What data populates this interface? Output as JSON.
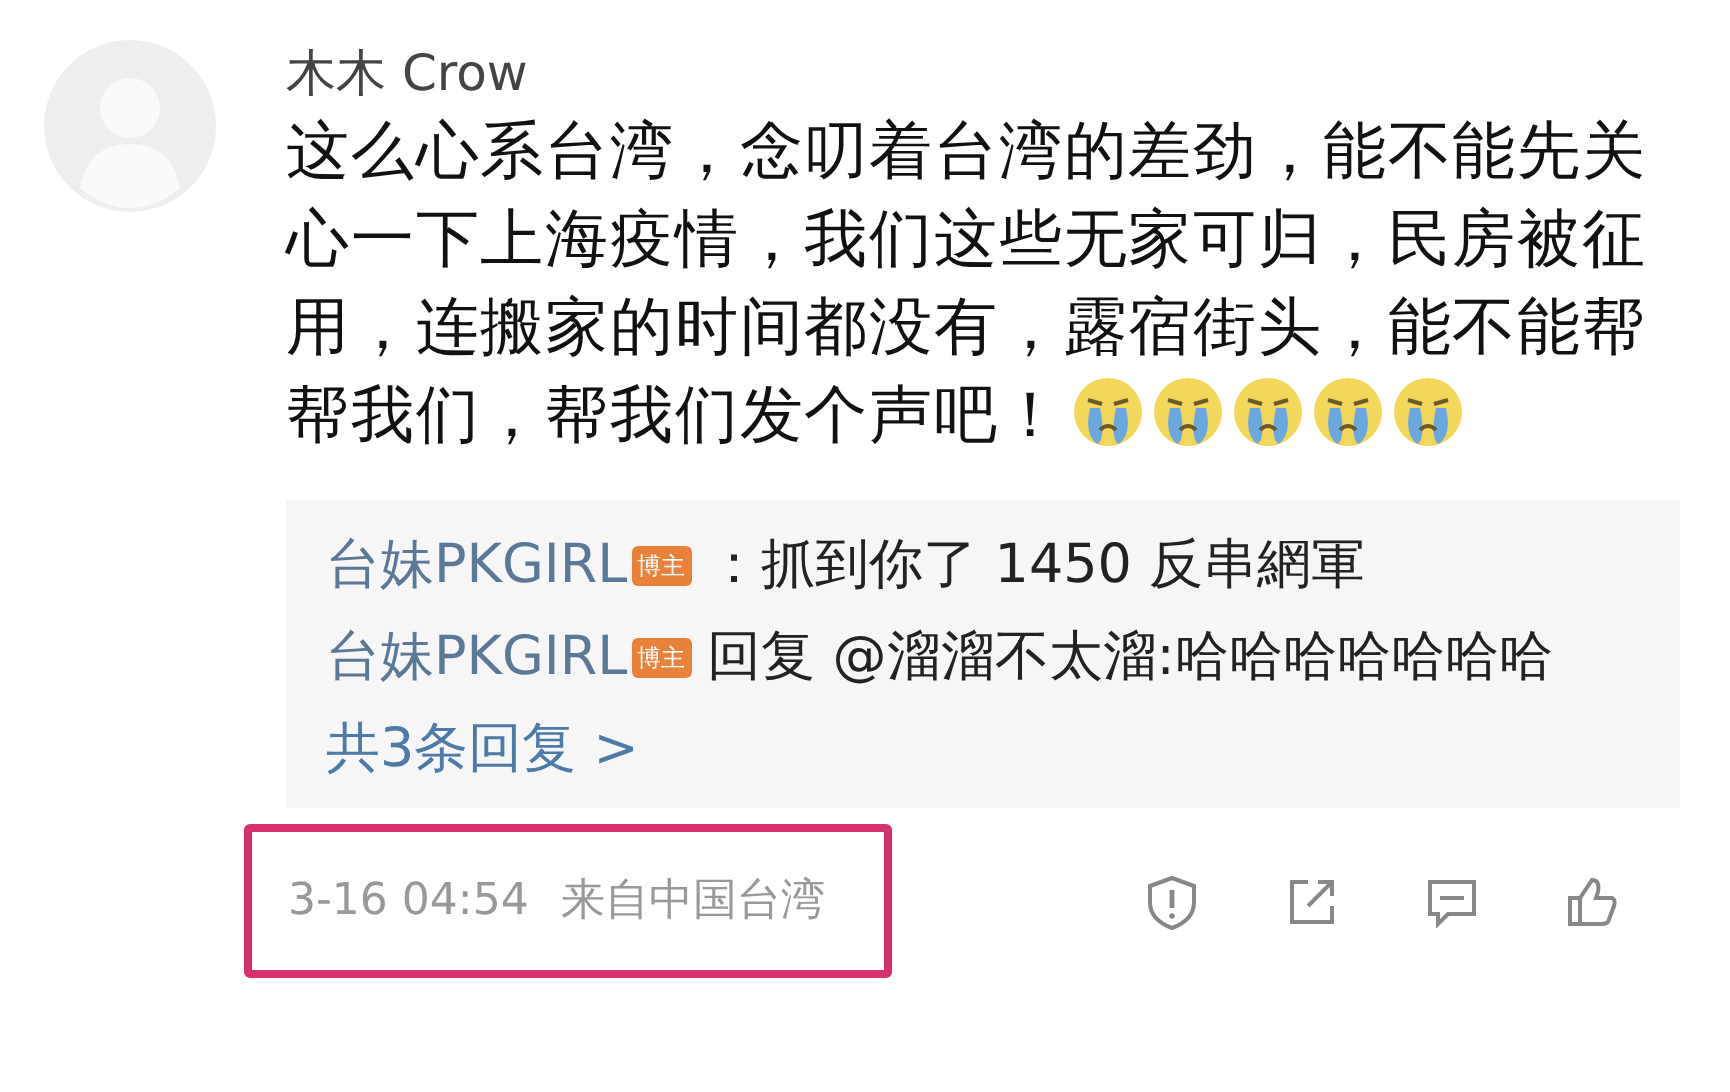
{
  "comment": {
    "author": "木木 Crow",
    "text": "这么心系台湾，念叨着台湾的差劲，能不能先关心一下上海疫情，我们这些无家可归，民房被征用，连搬家的时间都没有，露宿街头，能不能帮",
    "text_last_line": "帮我们，帮我们发个声吧！",
    "emojis": [
      {
        "kind": "crying"
      },
      {
        "kind": "crying"
      },
      {
        "kind": "crying"
      },
      {
        "kind": "crying"
      },
      {
        "kind": "crying"
      }
    ],
    "replies": [
      {
        "author": "台妹PKGIRL",
        "badge": "博主",
        "text": "：抓到你了 1450 反串網軍"
      },
      {
        "author": "台妹PKGIRL",
        "badge": "博主",
        "text": "回复 @溜溜不太溜:哈哈哈哈哈哈哈"
      }
    ],
    "more_replies": "共3条回复 >",
    "time": "3-16 04:54",
    "source": "来自中国台湾",
    "highlighted": true,
    "actions": [
      {
        "kind": "report"
      },
      {
        "kind": "share"
      },
      {
        "kind": "comment"
      },
      {
        "kind": "like"
      }
    ]
  }
}
